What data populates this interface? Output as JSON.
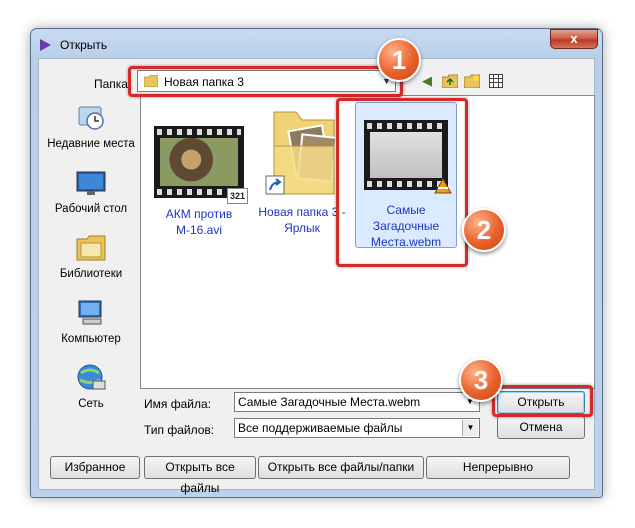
{
  "window": {
    "title": "Открыть",
    "close_label": "x"
  },
  "folder_bar": {
    "label": "Папка",
    "current": "Новая папка 3"
  },
  "places": [
    {
      "label": "Недавние места",
      "icon": "recent-places-icon"
    },
    {
      "label": "Рабочий стол",
      "icon": "desktop-icon"
    },
    {
      "label": "Библиотеки",
      "icon": "libraries-icon"
    },
    {
      "label": "Компьютер",
      "icon": "computer-icon"
    },
    {
      "label": "Сеть",
      "icon": "network-icon"
    }
  ],
  "files": [
    {
      "name": "АКМ против М-16.avi",
      "name_line1": "АКМ против",
      "name_line2": "М-16.avi",
      "badge": "321"
    },
    {
      "name": "Новая папка 3 - Ярлык",
      "name_line1": "Новая папка 3 -",
      "name_line2": "Ярлык"
    },
    {
      "name": "Самые Загадочные Места.webm",
      "name_line1": "Самые",
      "name_line2": "Загадочные",
      "name_line3": "Места.webm",
      "selected": true
    }
  ],
  "form": {
    "filename_label": "Имя файла:",
    "filename_value": "Самые Загадочные Места.webm",
    "filetype_label": "Тип файлов:",
    "filetype_value": "Все поддерживаемые файлы",
    "open_button": "Открыть",
    "cancel_button": "Отмена"
  },
  "bottom_buttons": {
    "favorites": "Избранное",
    "open_all_files": "Открыть все файлы",
    "open_all_files_folders": "Открыть все файлы/папки",
    "continuous": "Непрерывно"
  },
  "callouts": [
    "1",
    "2",
    "3"
  ],
  "colors": {
    "accent_red": "#d42a2a",
    "badge_orange": "#e8612a",
    "selection_blue": "#dceaff",
    "link_blue": "#1c35c4"
  }
}
